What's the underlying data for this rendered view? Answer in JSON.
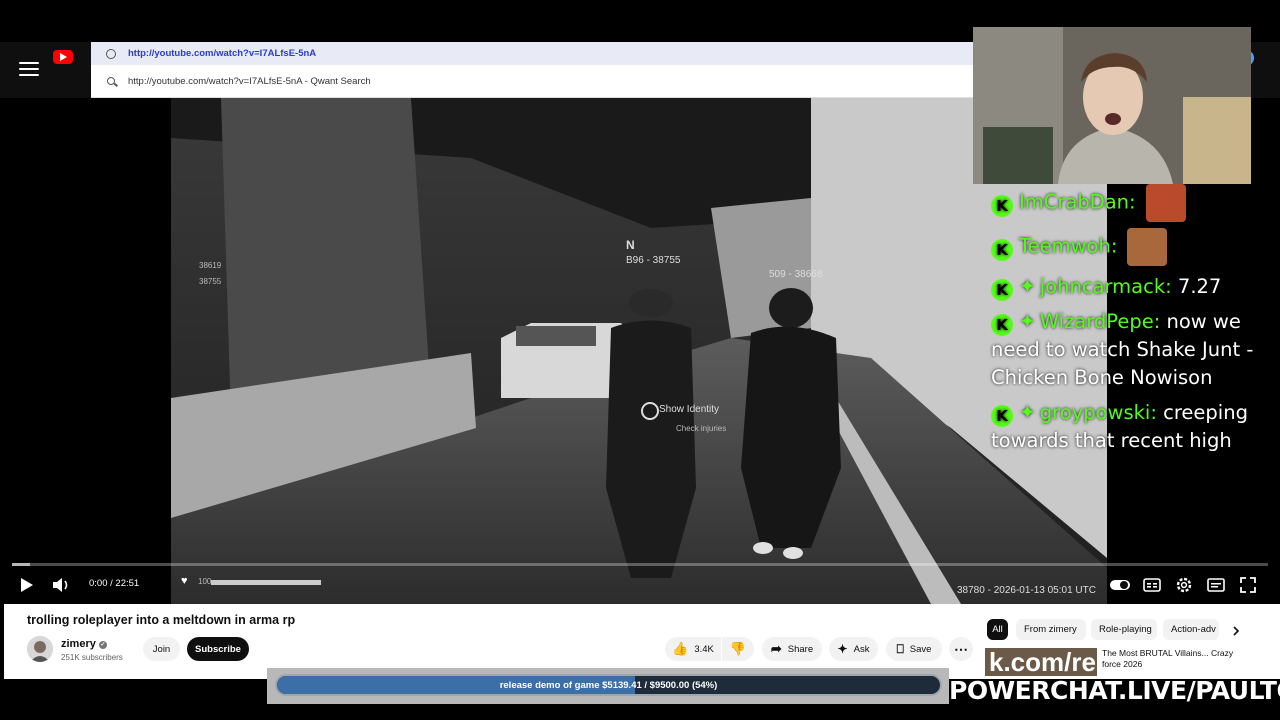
{
  "browser": {
    "url": "http://youtube.com/watch?v=I7ALfsE-5nA",
    "suggestion": "http://youtube.com/watch?v=I7ALfsE-5nA - Qwant Search"
  },
  "game_hud": {
    "marker_n": "N",
    "player_a": "B96 - 38755",
    "player_b": "509 - 38668",
    "prompt_primary": "Show Identity",
    "prompt_secondary": "Check injuries",
    "stat_1": "38619",
    "stat_2": "38755",
    "health": "100",
    "timestamp": "38780 - 2026-01-13 05:01 UTC"
  },
  "chat": [
    {
      "user": "ImCrabDan:",
      "text": "",
      "emote": "crab-face-emote",
      "sparkle": false
    },
    {
      "user": "Teemwoh:",
      "text": "",
      "emote": "laughing-face-emote",
      "sparkle": false
    },
    {
      "user": "johncarmack:",
      "text": "7.27",
      "sparkle": true
    },
    {
      "user": "WizardPepe:",
      "text": "now we need to watch Shake Junt - Chicken Bone Nowison",
      "sparkle": true
    },
    {
      "user": "groypowski:",
      "text": "creeping towards that recent high",
      "sparkle": true
    }
  ],
  "player": {
    "time": "0:00 / 22:51",
    "progress_fraction": 0.014
  },
  "video": {
    "title": "trolling roleplayer into a meltdown in arma rp",
    "channel": "zimery",
    "subscribers": "251K subscribers",
    "join_label": "Join",
    "subscribe_label": "Subscribe",
    "likes": "3.4K",
    "share_label": "Share",
    "ask_label": "Ask",
    "save_label": "Save"
  },
  "chips": [
    "All",
    "From zimery",
    "Role-playing",
    "Action-adv"
  ],
  "related": {
    "thumb_text": "k.com/re",
    "title": "The Most BRUTAL Villains... Crazy force 2026"
  },
  "donation": {
    "label": "release demo of game $5139.41 / $9500.00 (54%)",
    "fraction": 0.54
  },
  "stream_brand": "POWERCHAT.LIVE/PAULTOWN",
  "colors": {
    "kick_green": "#53fc18",
    "youtube_red": "#ff0000",
    "url_blue": "#2a3bd0"
  }
}
